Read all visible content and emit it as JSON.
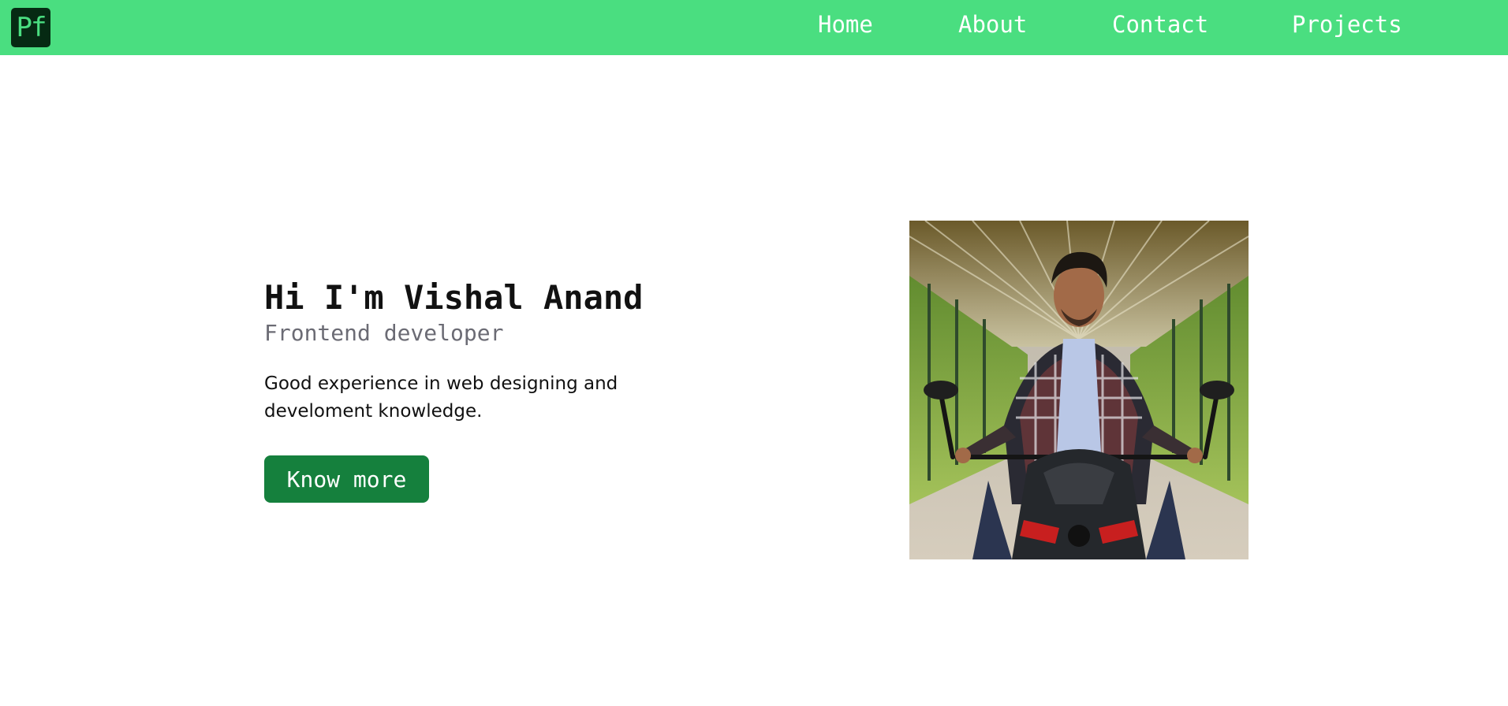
{
  "nav": {
    "logo": "Pf",
    "links": [
      "Home",
      "About",
      "Contact",
      "Projects"
    ]
  },
  "hero": {
    "title": "Hi I'm Vishal Anand",
    "subtitle": "Frontend developer",
    "description": "Good experience in web designing and develoment knowledge.",
    "cta_label": "Know more"
  },
  "colors": {
    "nav_bg": "#4ade80",
    "logo_bg": "#062a13",
    "cta_bg": "#15803d",
    "subtitle": "#6b6b74"
  }
}
